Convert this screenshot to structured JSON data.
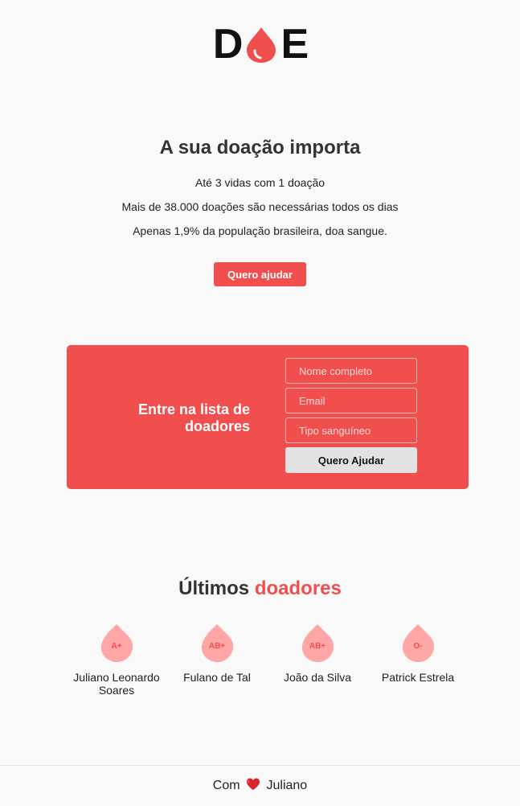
{
  "logo": {
    "left_letter": "D",
    "right_letter": "E"
  },
  "hero": {
    "title": "A sua doação importa",
    "lines": [
      "Até 3 vidas com 1 doação",
      "Mais de 38.000 doações são necessárias todos os dias",
      "Apenas 1,9% da população brasileira, doa sangue."
    ],
    "cta_label": "Quero ajudar"
  },
  "form": {
    "title": "Entre na lista de doadores",
    "name_placeholder": "Nome completo",
    "email_placeholder": "Email",
    "blood_placeholder": "Tipo sanguíneo",
    "submit_label": "Quero Ajudar"
  },
  "donors": {
    "title_plain": "Últimos",
    "title_accent": "doadores",
    "items": [
      {
        "blood_type": "A+",
        "name": "Juliano Leonardo Soares"
      },
      {
        "blood_type": "AB+",
        "name": "Fulano de Tal"
      },
      {
        "blood_type": "AB+",
        "name": "João da Silva"
      },
      {
        "blood_type": "O-",
        "name": "Patrick Estrela"
      }
    ]
  },
  "footer": {
    "prefix": "Com",
    "icon": "heart-icon",
    "suffix": "Juliano"
  },
  "colors": {
    "accent": "#f14e4e",
    "drop_light": "#ffa6a6",
    "background": "#f9f9f9"
  }
}
